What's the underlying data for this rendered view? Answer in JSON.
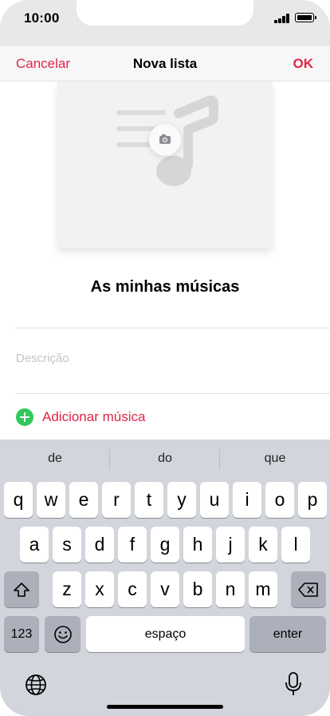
{
  "status_bar": {
    "time": "10:00"
  },
  "nav": {
    "cancel_label": "Cancelar",
    "title": "Nova lista",
    "ok_label": "OK"
  },
  "playlist": {
    "name": "As minhas músicas",
    "description_placeholder": "Descrição",
    "add_music_label": "Adicionar música"
  },
  "colors": {
    "accent": "#e0264a",
    "add_green": "#32c75a",
    "keyboard_bg": "#d2d5dc"
  },
  "keyboard": {
    "suggestions": [
      "de",
      "do",
      "que"
    ],
    "row1": [
      "q",
      "w",
      "e",
      "r",
      "t",
      "y",
      "u",
      "i",
      "o",
      "p"
    ],
    "row2": [
      "a",
      "s",
      "d",
      "f",
      "g",
      "h",
      "j",
      "k",
      "l"
    ],
    "row3": [
      "z",
      "x",
      "c",
      "v",
      "b",
      "n",
      "m"
    ],
    "numbers_label": "123",
    "space_label": "espaço",
    "enter_label": "enter",
    "icons": {
      "shift": "shift-icon",
      "backspace": "backspace-icon",
      "emoji": "emoji-icon",
      "globe": "globe-icon",
      "mic": "microphone-icon"
    }
  }
}
